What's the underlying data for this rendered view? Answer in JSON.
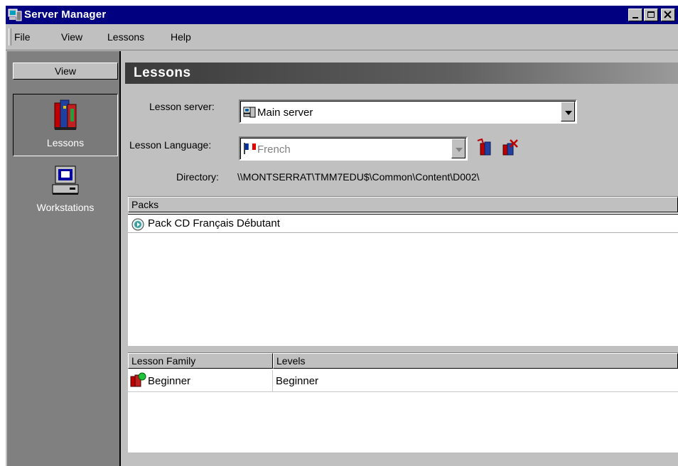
{
  "window": {
    "title": "Server Manager"
  },
  "menu": {
    "items": [
      {
        "label": "File"
      },
      {
        "label": "View"
      },
      {
        "label": "Lessons"
      },
      {
        "label": "Help"
      }
    ]
  },
  "sidebar": {
    "header": "View",
    "items": [
      {
        "label": "Lessons",
        "icon": "books-icon",
        "selected": true
      },
      {
        "label": "Workstations",
        "icon": "computer-icon",
        "selected": false
      }
    ]
  },
  "main": {
    "section_title": "Lessons",
    "lesson_server_label": "Lesson server:",
    "lesson_server_value": "Main server",
    "lesson_language_label": "Lesson Language:",
    "lesson_language_value": "French",
    "directory_label": "Directory:",
    "directory_value": "\\\\MONTSERRAT\\TMM7EDU$\\Common\\Content\\D002\\",
    "packs": {
      "header": "Packs",
      "rows": [
        {
          "name": "Pack CD Français Débutant"
        }
      ]
    },
    "families": {
      "columns": [
        "Lesson Family",
        "Levels"
      ],
      "rows": [
        {
          "family": "Beginner",
          "levels": "Beginner"
        }
      ]
    }
  },
  "colors": {
    "titlebar": "#000080",
    "face": "#c0c0c0",
    "sidebar": "#808080"
  }
}
